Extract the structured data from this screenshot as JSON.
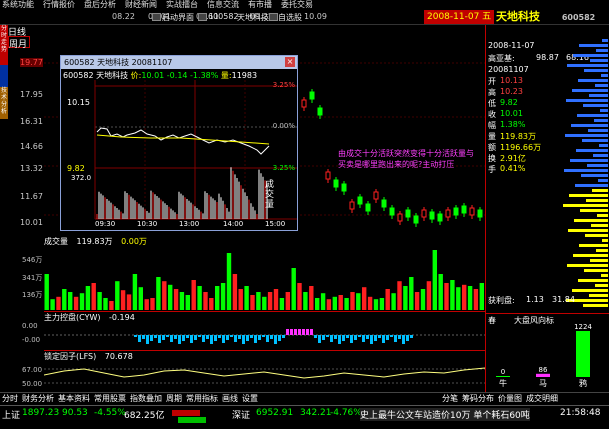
{
  "menu": [
    "系统功能",
    "行情报价",
    "盘后分析",
    "财经新闻",
    "实战擂台",
    "信息交流",
    "有市播",
    "委托交易"
  ],
  "toolbar": {
    "dates": [
      "08.22",
      "09.01",
      "09.11",
      "09.23",
      "10.09"
    ],
    "open_label": "启动界面",
    "code": "600582",
    "name": "天地科技",
    "custom": "自选股"
  },
  "date_box": "2008-11-07 五",
  "stock_name_top": "天地科技",
  "right_code": "600582",
  "left_tabs": [
    "分时走势",
    "技术分析"
  ],
  "period": "日线",
  "cycle": "周月",
  "price_axis": [
    "19.77",
    "17.95",
    "16.31",
    "14.66",
    "13.32",
    "11.67",
    "10.01"
  ],
  "popup": {
    "title": "600582 天地科技 20081107",
    "close": "×",
    "info_code": "600582 天地科技",
    "info_price_label": "价:",
    "info_price": "10.01",
    "info_change": "-0.14",
    "info_pct": "-1.38%",
    "info_vol_label": "量:",
    "info_vol": "11983",
    "left_axis": [
      "10.15",
      "9.82"
    ],
    "right_axis": [
      "3.25%",
      "0.00%",
      "3.25%"
    ],
    "vol_axis": "372.0",
    "time_axis": [
      "09:30",
      "10:30",
      "13:00",
      "14:00",
      "15:00"
    ],
    "vol_title": "成交量"
  },
  "volume": {
    "label": "成交量",
    "value": "119.83万",
    "value2": "0.00万",
    "axis": [
      "546万",
      "341万",
      "136万"
    ],
    "bars": [
      60,
      18,
      22,
      35,
      30,
      22,
      28,
      40,
      45,
      30,
      20,
      15,
      48,
      33,
      26,
      60,
      38,
      18,
      20,
      55,
      48,
      42,
      35,
      30,
      25,
      50,
      40,
      30,
      20,
      40,
      45,
      95,
      60,
      35,
      40,
      25,
      30,
      22,
      30,
      35,
      20,
      30,
      70,
      45,
      30,
      40,
      20,
      28,
      18,
      22,
      25,
      20,
      30,
      28,
      38,
      22,
      18,
      20,
      35,
      28,
      48,
      40,
      55,
      30,
      35,
      48,
      100,
      60,
      45,
      50,
      38,
      42,
      40,
      35,
      45
    ],
    "up": [
      1,
      1,
      0,
      1,
      1,
      0,
      1,
      1,
      0,
      1,
      1,
      0,
      1,
      0,
      0,
      1,
      1,
      0,
      0,
      1,
      0,
      1,
      0,
      1,
      1,
      0,
      1,
      0,
      0,
      1,
      1,
      1,
      0,
      0,
      1,
      0,
      1,
      1,
      0,
      0,
      1,
      0,
      1,
      0,
      1,
      0,
      1,
      1,
      0,
      1,
      0,
      1,
      0,
      1,
      0,
      0,
      1,
      1,
      0,
      1,
      0,
      1,
      1,
      0,
      1,
      0,
      1,
      1,
      0,
      1,
      1,
      0,
      1,
      0,
      1
    ]
  },
  "control": {
    "label": "主力控盘(CYW)",
    "value": "-0.194",
    "axis": [
      "0.00",
      "-0.00"
    ]
  },
  "lfs": {
    "label": "锁定因子(LFS)",
    "value": "70.678",
    "axis": [
      "67.00",
      "50.00"
    ]
  },
  "annotation": "由成交十分活跃突然变得十分活跃量与买卖是哪里跑出来的呢?主动打压",
  "tabs": [
    "分时",
    "财务分析",
    "基本资料",
    "常用股票",
    "指数叠加",
    "周期",
    "常用指标",
    "画线",
    "设置"
  ],
  "right_tabs": [
    "分笔",
    "筹码分布",
    "价量图",
    "成交明细"
  ],
  "status": {
    "sh_label": "上证",
    "sh_index": "1897.23",
    "sh_change": "90.53",
    "sh_pct": "-4.55%",
    "sh_amount": "682.25亿",
    "sz_label": "深证",
    "sz_index": "6952.91",
    "sz_change": "342.21",
    "sz_pct": "-4.76%",
    "scroll_text": "史上最牛公文车站造价10万 单个耗石60吨",
    "time": "21:58:48"
  },
  "right_panel": {
    "date": "2008-11-07",
    "label_header": "高亚基:",
    "header_vals": [
      "98.87",
      "68.16"
    ],
    "date2": "20081107",
    "rows": [
      {
        "k": "开",
        "v": "10.13"
      },
      {
        "k": "高",
        "v": "10.23"
      },
      {
        "k": "低",
        "v": "9.82"
      },
      {
        "k": "收",
        "v": "10.01"
      },
      {
        "k": "幅",
        "v": "1.38%"
      },
      {
        "k": "量",
        "v": "119.83万"
      },
      {
        "k": "额",
        "v": "1196.66万"
      },
      {
        "k": "换",
        "v": "2.91亿"
      },
      {
        "k": "手",
        "v": "0.41%"
      }
    ],
    "profit_label": "获利盘:",
    "profit_vals": [
      "1.13",
      "31.84"
    ],
    "wind_title": "大盘风向标",
    "season": "春",
    "bars_labels": [
      "牛",
      "马",
      "鸦"
    ],
    "bars_values": [
      "0",
      "86",
      "1224"
    ]
  }
}
